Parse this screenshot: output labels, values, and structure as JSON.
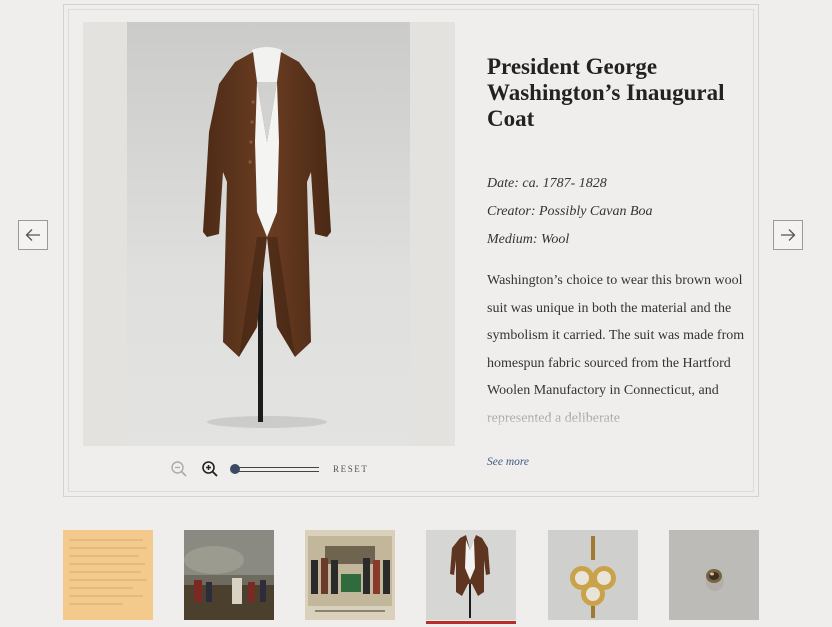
{
  "nav": {
    "prev_icon": "arrow-left-icon",
    "next_icon": "arrow-right-icon"
  },
  "viewer": {
    "zoom_out_icon": "zoom-out-icon",
    "zoom_in_icon": "zoom-in-icon",
    "zoom_level": 0,
    "reset_label": "RESET"
  },
  "artifact": {
    "title": "President George Washington’s Inaugural Coat",
    "date": "Date: ca. 1787- 1828",
    "creator": "Creator: Possibly Cavan Boa",
    "medium": "Medium: Wool",
    "description": "Washington’s choice to wear this brown wool suit was unique in both the material and the symbolism it carried. The suit was made from homespun fabric sourced from the Hartford Woolen Manufactory in Connecticut, and represented a deliberate",
    "see_more": "See more"
  },
  "thumbnails": {
    "active_index": 3,
    "colors": {
      "accent": "#b5302b"
    }
  }
}
